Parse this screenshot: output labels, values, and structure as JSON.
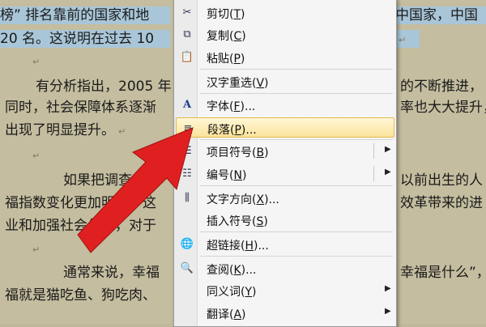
{
  "document": {
    "lines": [
      {
        "text": "榜” 排名靠前的国家和地",
        "right": "中国家，中国",
        "selected": true
      },
      {
        "text": "20 名。这说明在过去 10",
        "right": "",
        "selected": true
      },
      {
        "text": "有分析指出，2005 年",
        "right": "的不断推进，",
        "selected": false
      },
      {
        "text": "同时，社会保障体系逐渐",
        "right": "率也大大提升，",
        "selected": false
      },
      {
        "text": "出现了明显提升。",
        "right": "",
        "selected": false
      },
      {
        "text": "如果把调查人群",
        "right": "以前出生的人",
        "selected": false
      },
      {
        "text": "福指数变化更加明显，这",
        "right": "效革带来的进",
        "selected": false
      },
      {
        "text": "业和加强社会保障，对于",
        "right": "",
        "selected": false
      },
      {
        "text": "通常来说，幸福",
        "right": "幸福是什么”，",
        "selected": false
      },
      {
        "text": "福就是猫吃鱼、狗吃肉、",
        "right": "",
        "selected": false
      }
    ],
    "para_mark": "↵"
  },
  "context_menu": {
    "items": [
      {
        "key": "cut",
        "prefix": "剪切(",
        "accel": "T",
        "suffix": ")",
        "icon": "scissors-icon"
      },
      {
        "key": "copy",
        "prefix": "复制(",
        "accel": "C",
        "suffix": ")",
        "icon": "copy-icon"
      },
      {
        "key": "paste",
        "prefix": "粘贴(",
        "accel": "P",
        "suffix": ")",
        "icon": "paste-icon"
      },
      {
        "key": "reconvert",
        "prefix": "汉字重选(",
        "accel": "V",
        "suffix": ")",
        "icon": ""
      },
      {
        "key": "font",
        "prefix": "字体(",
        "accel": "F",
        "suffix": ")...",
        "icon": "font-icon"
      },
      {
        "key": "paragraph",
        "prefix": "段落(",
        "accel": "P",
        "suffix": ")...",
        "icon": "paragraph-icon",
        "highlighted": true
      },
      {
        "key": "bullets",
        "prefix": "项目符号(",
        "accel": "B",
        "suffix": ")",
        "icon": "bullets-icon",
        "submenu": true
      },
      {
        "key": "numbering",
        "prefix": "编号(",
        "accel": "N",
        "suffix": ")",
        "icon": "numbering-icon",
        "submenu": true
      },
      {
        "key": "text_dir",
        "prefix": "文字方向(",
        "accel": "X",
        "suffix": ")...",
        "icon": "text-direction-icon"
      },
      {
        "key": "symbol",
        "prefix": "插入符号(",
        "accel": "S",
        "suffix": ")",
        "icon": ""
      },
      {
        "key": "hyperlink",
        "prefix": "超链接(",
        "accel": "H",
        "suffix": ")...",
        "icon": "hyperlink-icon"
      },
      {
        "key": "lookup",
        "prefix": "查阅(",
        "accel": "K",
        "suffix": ")...",
        "icon": "lookup-icon"
      },
      {
        "key": "synonyms",
        "prefix": "同义词(",
        "accel": "Y",
        "suffix": ")",
        "icon": "",
        "submenu": true
      },
      {
        "key": "translate",
        "prefix": "翻译(",
        "accel": "A",
        "suffix": ")",
        "icon": "",
        "submenu": true
      }
    ]
  },
  "colors": {
    "arrow": "#e02020",
    "highlight_border": "#e2b84c",
    "selection": "#a9c6d8"
  }
}
